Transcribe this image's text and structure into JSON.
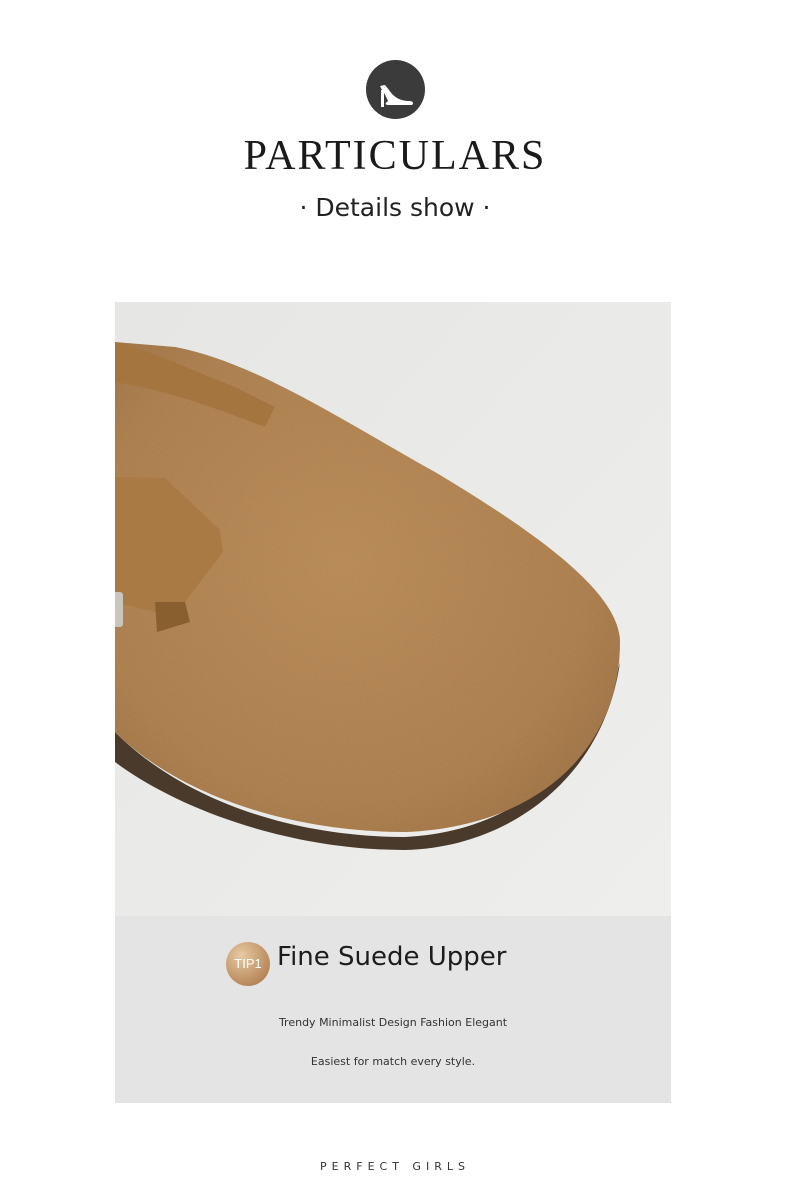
{
  "header": {
    "icon": "high-heel-icon",
    "title": "PARTICULARS",
    "subtitle": "· Details show ·"
  },
  "photo": {
    "subject": "suede-clog-toe-photo",
    "colors": {
      "suede": "#b4834f",
      "sole": "#4a3a2c",
      "background": "#e8e8e6"
    }
  },
  "caption": {
    "badge": "TIP1",
    "title": "Fine Suede Upper",
    "line1": "Trendy Minimalist Design Fashion Elegant",
    "line2": "Easiest for match every style."
  },
  "footer": {
    "text": "PERFECT GIRLS"
  }
}
